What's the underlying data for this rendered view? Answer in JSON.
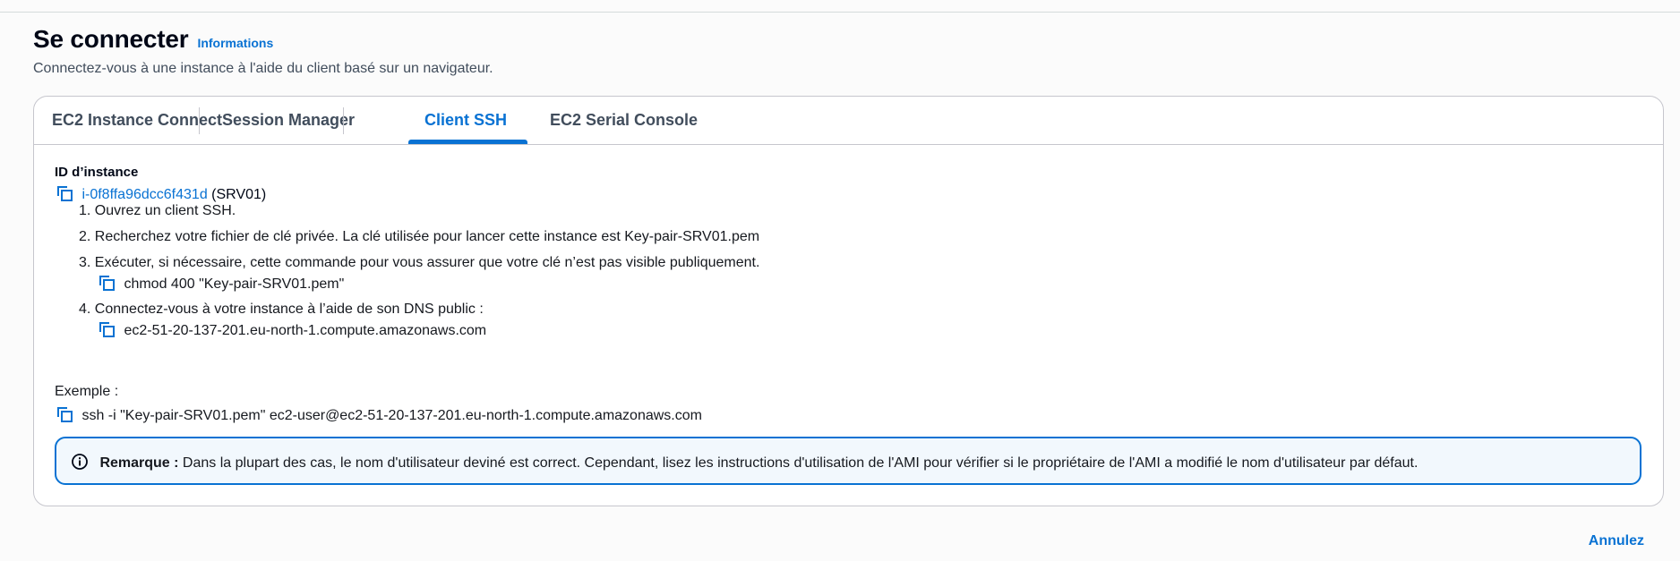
{
  "header": {
    "title": "Se connecter",
    "info_link": "Informations",
    "subtitle": "Connectez-vous à une instance à l'aide du client basé sur un navigateur."
  },
  "tabs": [
    {
      "label": "EC2 Instance Connect",
      "active": false
    },
    {
      "label": "Session Manager",
      "active": false
    },
    {
      "label": "Client SSH",
      "active": true
    },
    {
      "label": "EC2 Serial Console",
      "active": false
    }
  ],
  "instance": {
    "label": "ID d’instance",
    "id": "i-0f8ffa96dcc6f431d",
    "name": "(SRV01)"
  },
  "steps": [
    "1. Ouvrez un client SSH.",
    "2. Recherchez votre fichier de clé privée. La clé utilisée pour lancer cette instance est Key-pair-SRV01.pem",
    "3. Exécuter, si nécessaire, cette commande pour vous assurer que votre clé n’est pas visible publiquement.",
    "4. Connectez-vous à votre instance à l’aide de son DNS public :"
  ],
  "commands": {
    "chmod": "chmod 400 \"Key-pair-SRV01.pem\"",
    "dns": "ec2-51-20-137-201.eu-north-1.compute.amazonaws.com"
  },
  "example": {
    "label": "Exemple :",
    "command": "ssh -i \"Key-pair-SRV01.pem\" ec2-user@ec2-51-20-137-201.eu-north-1.compute.amazonaws.com"
  },
  "note": {
    "bold": "Remarque :",
    "text": " Dans la plupart des cas, le nom d'utilisateur deviné est correct. Cependant, lisez les instructions d'utilisation de l'AMI pour vérifier si le propriétaire de l'AMI a modifié le nom d'utilisateur par défaut."
  },
  "footer": {
    "cancel_label": "Annulez"
  },
  "colors": {
    "accent": "#0972d3",
    "text": "#000716",
    "border": "#c6c6cd"
  },
  "icons": [
    "copy-icon",
    "info-icon"
  ]
}
